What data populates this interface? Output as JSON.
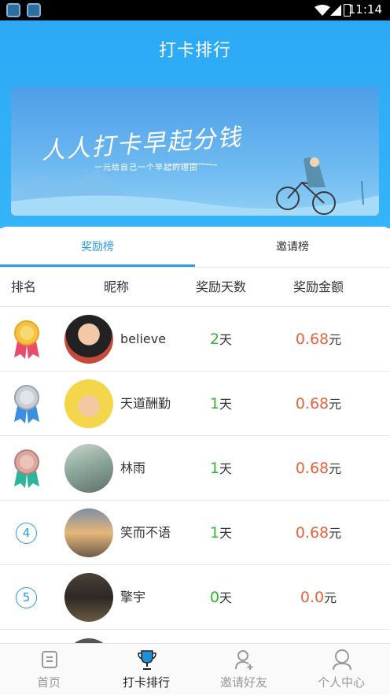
{
  "status_bar": {
    "time": "11:14"
  },
  "header": {
    "title": "打卡排行"
  },
  "banner": {
    "headline": "人人打卡早起分钱",
    "subline": "一元给自己一个早起的理由"
  },
  "tabs": [
    {
      "label": "奖励榜",
      "active": true
    },
    {
      "label": "邀请榜",
      "active": false
    }
  ],
  "table": {
    "headers": {
      "rank": "排名",
      "nickname": "昵称",
      "days": "奖励天数",
      "amount": "奖励金额"
    },
    "day_unit": "天",
    "amount_unit": "元",
    "rows": [
      {
        "rank": "1",
        "nickname": "believe",
        "days": "2",
        "amount": "0.68"
      },
      {
        "rank": "2",
        "nickname": "天道酬勤",
        "days": "1",
        "amount": "0.68"
      },
      {
        "rank": "3",
        "nickname": "林雨",
        "days": "1",
        "amount": "0.68"
      },
      {
        "rank": "4",
        "nickname": "笑而不语",
        "days": "1",
        "amount": "0.68"
      },
      {
        "rank": "5",
        "nickname": "擎宇",
        "days": "0",
        "amount": "0.0"
      }
    ]
  },
  "bottom_nav": [
    {
      "label": "首页",
      "icon": "home-icon",
      "active": false
    },
    {
      "label": "打卡排行",
      "icon": "trophy-icon",
      "active": true
    },
    {
      "label": "邀请好友",
      "icon": "add-user-icon",
      "active": false
    },
    {
      "label": "个人中心",
      "icon": "person-icon",
      "active": false
    }
  ],
  "colors": {
    "primary": "#2a9ce6",
    "days_green": "#2fb82f",
    "amount_orange": "#e8623a"
  }
}
